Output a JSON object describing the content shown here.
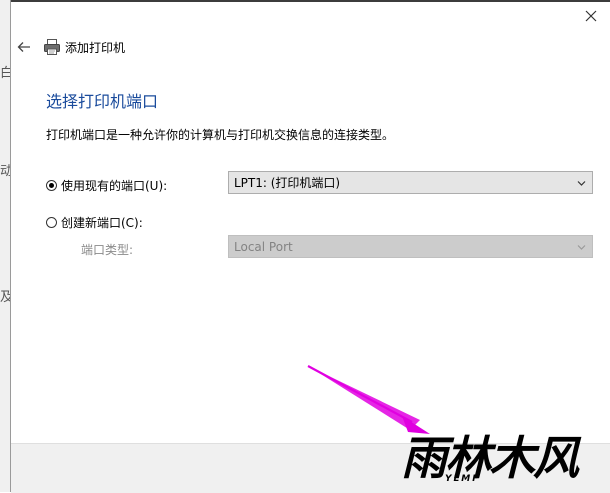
{
  "background_glyphs": [
    "白",
    "动",
    "及"
  ],
  "header": {
    "wizard_title": "添加打印机"
  },
  "page": {
    "heading": "选择打印机端口",
    "description": "打印机端口是一种允许你的计算机与打印机交换信息的连接类型。"
  },
  "options": {
    "existing_port": {
      "label": "使用现有的端口(U):",
      "selected": true,
      "value": "LPT1: (打印机端口)"
    },
    "new_port": {
      "label": "创建新端口(C):",
      "selected": false,
      "type_label": "端口类型:",
      "type_value": "Local Port"
    }
  },
  "watermark": {
    "brand": "雨林木风",
    "sub": "YLMF"
  },
  "colors": {
    "heading": "#1a4b9c",
    "annotation_arrow": "#e000e0"
  }
}
